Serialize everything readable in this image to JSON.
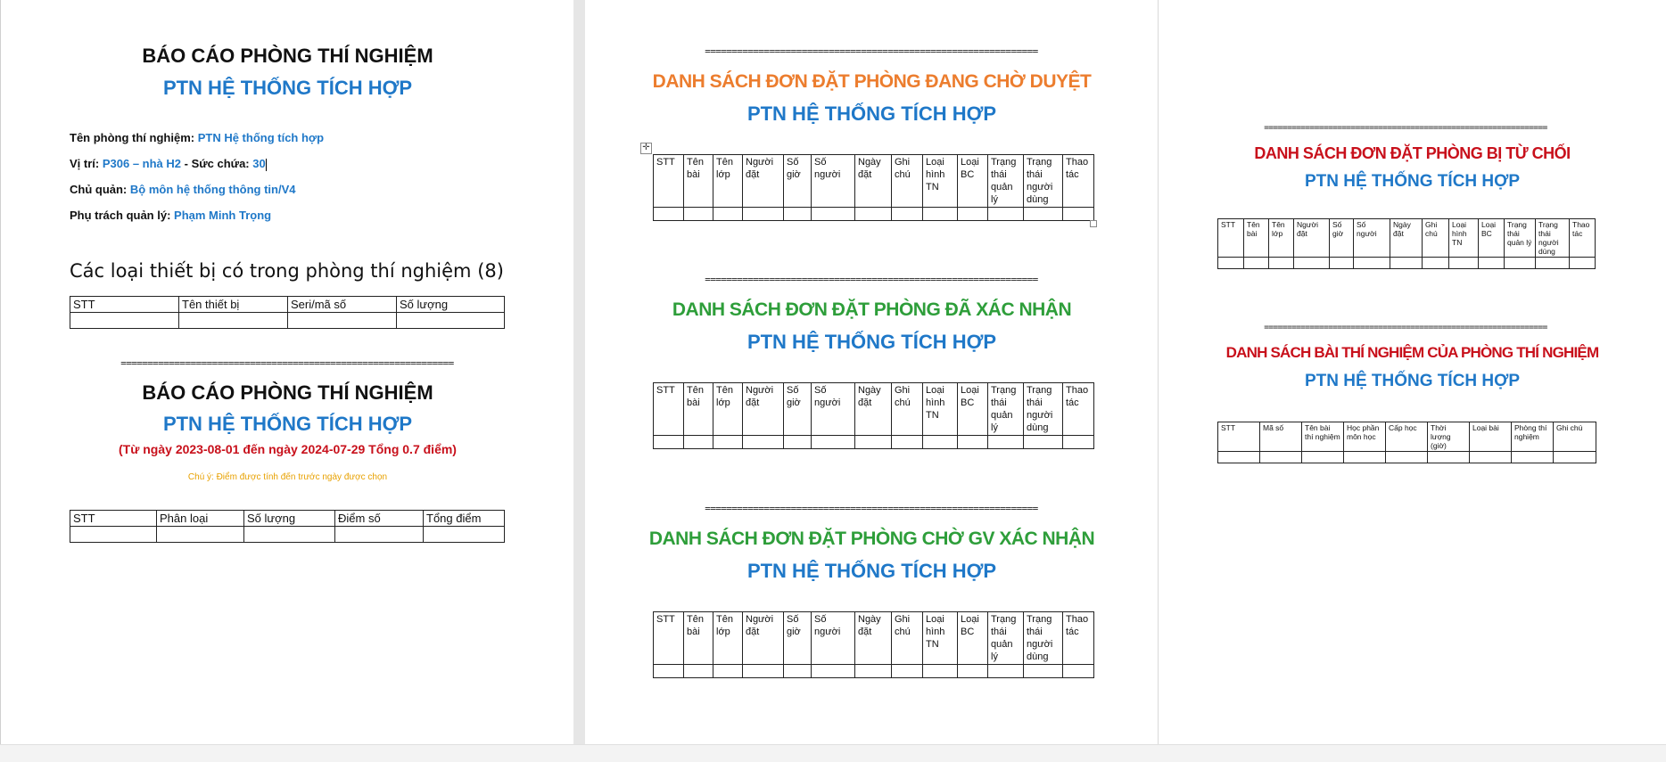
{
  "page1": {
    "report_title": "BÁO CÁO PHÒNG THÍ NGHIỆM",
    "lab_name": "PTN HỆ THỐNG TÍCH HỢP",
    "info": {
      "name_label": "Tên phòng thí nghiệm:",
      "name_value": "PTN Hệ thống tích hợp",
      "location_label": "Vị trí:",
      "location_value": "P306 – nhà H2",
      "capacity_label": " - Sức chứa:",
      "capacity_value": "30",
      "owner_label": "Chủ quản:",
      "owner_value": "Bộ môn hệ thống thông tin/V4",
      "manager_label": "Phụ trách quản lý:",
      "manager_value": "Phạm Minh Trọng"
    },
    "equipment_heading": "Các loại thiết bị có trong phòng thí nghiệm (8)",
    "equipment_columns": [
      "STT",
      "Tên thiết bị",
      "Seri/mã số",
      "Số lượng"
    ],
    "separator": "==============================================================",
    "report2_title": "BÁO CÁO PHÒNG THÍ NGHIỆM",
    "report2_lab": "PTN HỆ THỐNG TÍCH HỢP",
    "date_range": "(Từ ngày 2023-08-01 đến ngày 2024-07-29 Tổng 0.7 điểm)",
    "note": "Chú ý: Điểm được tính đến trước ngày được chọn",
    "score_columns": [
      "STT",
      "Phân loại",
      "Số lượng",
      "Điểm số",
      "Tổng điểm"
    ],
    "colors": {
      "blue": "#1f78c8",
      "red": "#c8101b",
      "note_orange": "#e8a100"
    }
  },
  "page2": {
    "separator": "==============================================================",
    "pending_title": "DANH SÁCH ĐƠN ĐẶT PHÒNG ĐANG CHỜ DUYỆT",
    "confirmed_title": "DANH SÁCH ĐƠN ĐẶT PHÒNG ĐÃ XÁC NHẬN",
    "gv_title": "DANH SÁCH ĐƠN ĐẶT PHÒNG CHỜ GV XÁC NHẬN",
    "lab_name": "PTN HỆ THỐNG TÍCH HỢP",
    "booking_columns": [
      "STT",
      "Tên bài",
      "Tên lớp",
      "Người đặt",
      "Số giờ",
      "Số người",
      "Ngày đặt",
      "Ghi chú",
      "Loại hình TN",
      "Loại BC",
      "Trạng thái quản lý",
      "Trạng thái người dùng",
      "Thao tác"
    ],
    "colors": {
      "orange": "#ec7d2e",
      "green": "#2e9e3a"
    }
  },
  "page3": {
    "separator": "==============================================================",
    "rejected_title": "DANH SÁCH ĐƠN ĐẶT PHÒNG BỊ TỪ CHỐI",
    "experiments_title": "DANH SÁCH BÀI THÍ NGHIỆM CỦA PHÒNG THÍ NGHIỆM",
    "lab_name": "PTN HỆ THỐNG TÍCH HỢP",
    "booking_columns": [
      "STT",
      "Tên bài",
      "Tên lớp",
      "Người đặt",
      "Số giờ",
      "Số người",
      "Ngày đặt",
      "Ghi chú",
      "Loại hình TN",
      "Loại BC",
      "Trạng thái quản lý",
      "Trạng thái người dùng",
      "Thao tác"
    ],
    "experiment_columns": [
      "STT",
      "Mã số",
      "Tên bài thí nghiệm",
      "Học phần môn học",
      "Cấp học",
      "Thời lượng (giờ)",
      "Loại bài",
      "Phòng thí nghiệm",
      "Ghi chú"
    ],
    "colors": {
      "red": "#c8101b"
    }
  }
}
